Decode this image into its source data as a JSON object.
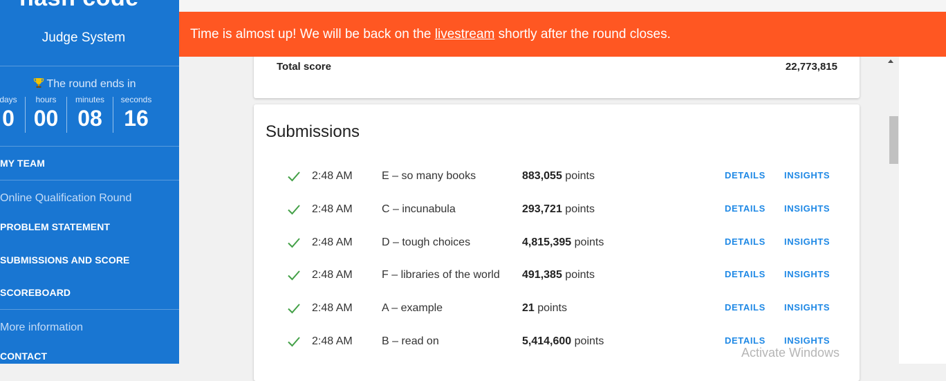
{
  "sidebar": {
    "logo": "hash code",
    "subtitle": "Judge System",
    "countdown": {
      "title": "The round ends in",
      "units": [
        {
          "label": "days",
          "value": "0"
        },
        {
          "label": "hours",
          "value": "00"
        },
        {
          "label": "minutes",
          "value": "08"
        },
        {
          "label": "seconds",
          "value": "16"
        }
      ]
    },
    "my_team": "MY TEAM",
    "round_section": "Online Qualification Round",
    "links": [
      "PROBLEM STATEMENT",
      "SUBMISSIONS AND SCORE",
      "SCOREBOARD"
    ],
    "more_section": "More information",
    "contact": "CONTACT"
  },
  "banner": {
    "before": "Time is almost up! We will be back on the ",
    "link": "livestream",
    "after": " shortly after the round closes."
  },
  "total": {
    "label": "Total score",
    "value": "22,773,815"
  },
  "submissions": {
    "title": "Submissions",
    "points_suffix": "points",
    "details_label": "DETAILS",
    "insights_label": "INSIGHTS",
    "rows": [
      {
        "time": "2:48 AM",
        "problem": "E – so many books",
        "points": "883,055"
      },
      {
        "time": "2:48 AM",
        "problem": "C – incunabula",
        "points": "293,721"
      },
      {
        "time": "2:48 AM",
        "problem": "D – tough choices",
        "points": "4,815,395"
      },
      {
        "time": "2:48 AM",
        "problem": "F – libraries of the world",
        "points": "491,385"
      },
      {
        "time": "2:48 AM",
        "problem": "A – example",
        "points": "21"
      },
      {
        "time": "2:48 AM",
        "problem": "B – read on",
        "points": "5,414,600"
      }
    ]
  },
  "watermark": "Activate Windows",
  "colors": {
    "sidebar": "#1976d2",
    "banner": "#ff5722",
    "accent": "#1e88e5",
    "check": "#43a047"
  }
}
